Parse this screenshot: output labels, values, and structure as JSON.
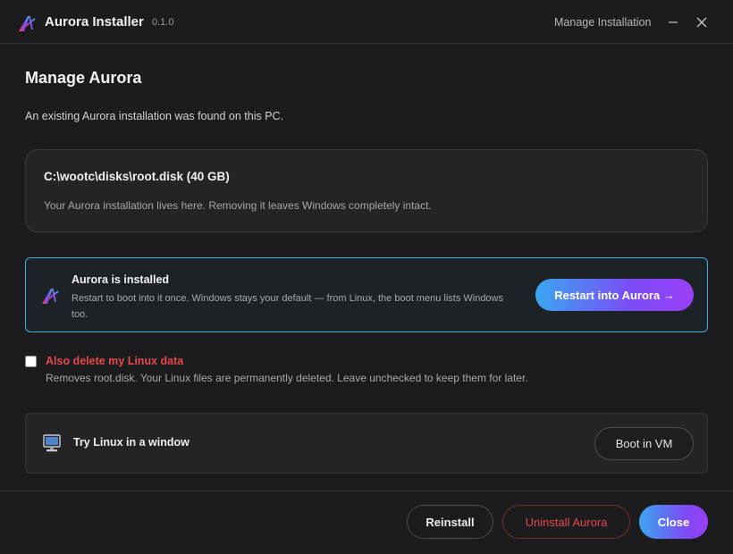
{
  "titlebar": {
    "app_title": "Aurora Installer",
    "version": "0.1.0",
    "manage_link": "Manage Installation",
    "icons": {
      "logo": "aurora-logo-icon",
      "minimize": "minimize-icon",
      "close": "close-icon"
    }
  },
  "main": {
    "page_title": "Manage Aurora",
    "intro": "An existing Aurora installation was found on this PC.",
    "path_card": {
      "title": "C:\\wootc\\disks\\root.disk (40 GB)",
      "description": "Your Aurora installation lives here. Removing it leaves Windows completely intact."
    },
    "status_card": {
      "title": "Aurora is installed",
      "description": "Restart to boot into it once. Windows stays your default — from Linux, the boot menu lists Windows too.",
      "button": "Restart into Aurora →"
    },
    "delete_option": {
      "checked": false,
      "label": "Also delete my Linux data",
      "description": "Removes root.disk. Your Linux files are permanently deleted. Leave unchecked to keep them for later."
    },
    "vm_card": {
      "icon": "monitor-icon",
      "title": "Try Linux in a window",
      "button": "Boot in VM"
    }
  },
  "footer": {
    "reinstall": "Reinstall",
    "uninstall": "Uninstall Aurora",
    "close": "Close"
  },
  "colors": {
    "background": "#1c1c1e",
    "accent_gradient_start": "#3aa7f0",
    "accent_gradient_end": "#9a3ff6",
    "danger": "#e5484d",
    "status_border": "#3fb0d8"
  }
}
